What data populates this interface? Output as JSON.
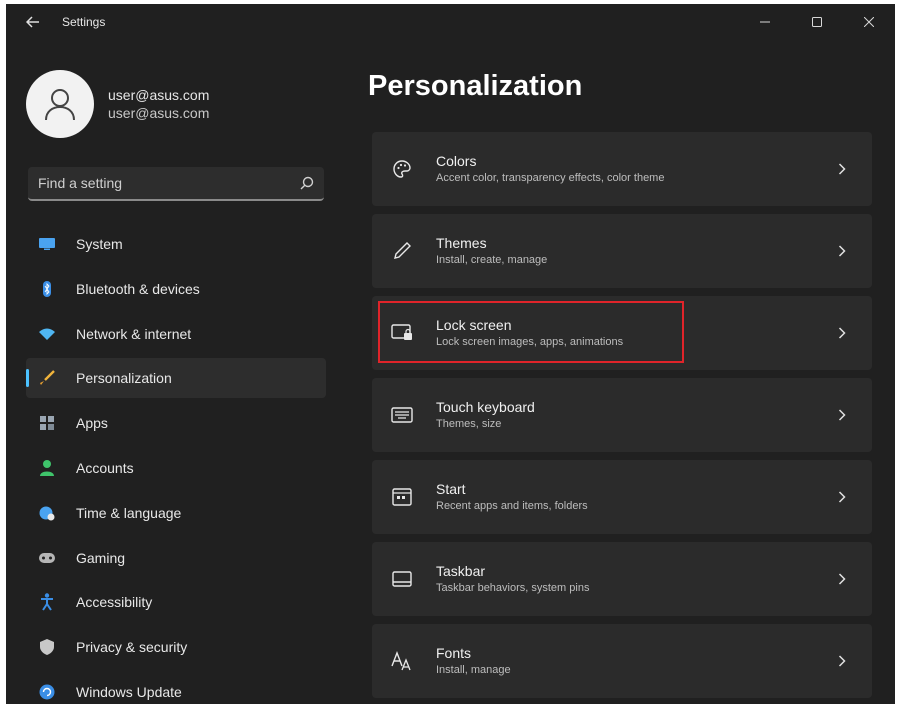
{
  "window": {
    "title": "Settings"
  },
  "profile": {
    "name": "user@asus.com",
    "email": "user@asus.com"
  },
  "search": {
    "placeholder": "Find a setting"
  },
  "sidebar": {
    "items": [
      {
        "label": "System",
        "icon": "system-icon",
        "color": "#4aa3f0"
      },
      {
        "label": "Bluetooth & devices",
        "icon": "bluetooth-icon",
        "color": "#3a8ee6"
      },
      {
        "label": "Network & internet",
        "icon": "wifi-icon",
        "color": "#4fb6f2"
      },
      {
        "label": "Personalization",
        "icon": "brush-icon",
        "color": "#f0b43c",
        "active": true
      },
      {
        "label": "Apps",
        "icon": "apps-icon",
        "color": "#9aa6b2"
      },
      {
        "label": "Accounts",
        "icon": "accounts-icon",
        "color": "#3fc46b"
      },
      {
        "label": "Time & language",
        "icon": "globe-clock-icon",
        "color": "#4aa3f0"
      },
      {
        "label": "Gaming",
        "icon": "gamepad-icon",
        "color": "#b5b5b5"
      },
      {
        "label": "Accessibility",
        "icon": "accessibility-icon",
        "color": "#3a8ee6"
      },
      {
        "label": "Privacy & security",
        "icon": "shield-icon",
        "color": "#c8c8c8"
      },
      {
        "label": "Windows Update",
        "icon": "update-icon",
        "color": "#3a8ee6"
      }
    ]
  },
  "main": {
    "title": "Personalization",
    "cards": [
      {
        "title": "Colors",
        "description": "Accent color, transparency effects, color theme",
        "icon": "palette-icon"
      },
      {
        "title": "Themes",
        "description": "Install, create, manage",
        "icon": "pen-icon"
      },
      {
        "title": "Lock screen",
        "description": "Lock screen images, apps, animations",
        "icon": "lock-screen-icon"
      },
      {
        "title": "Touch keyboard",
        "description": "Themes, size",
        "icon": "keyboard-icon"
      },
      {
        "title": "Start",
        "description": "Recent apps and items, folders",
        "icon": "start-icon"
      },
      {
        "title": "Taskbar",
        "description": "Taskbar behaviors, system pins",
        "icon": "taskbar-icon"
      },
      {
        "title": "Fonts",
        "description": "Install, manage",
        "icon": "fonts-icon"
      }
    ]
  },
  "colors": {
    "background": "#202020",
    "card": "#2b2b2b",
    "accent": "#4cc2ff",
    "highlight": "#e0242a"
  }
}
